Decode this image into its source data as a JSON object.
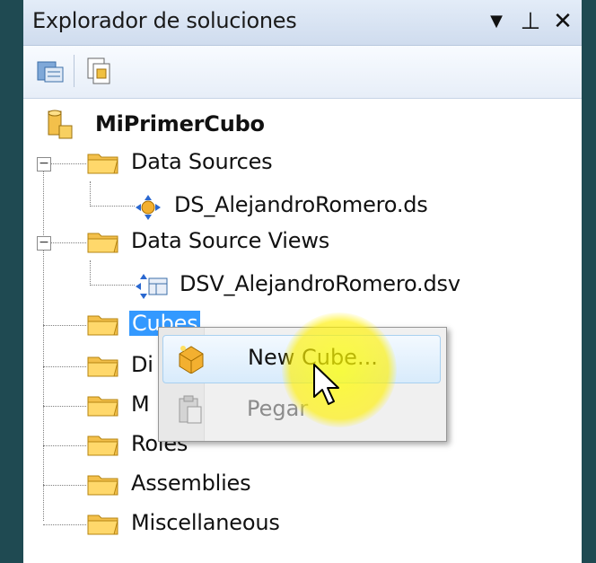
{
  "panel": {
    "title": "Explorador de soluciones",
    "buttons": {
      "dropdown": "▼",
      "pin": "⊥",
      "close": "✕"
    }
  },
  "toolbar": {
    "icons": [
      "properties-icon",
      "show-all-files-icon"
    ]
  },
  "tree": {
    "root": "MiPrimerCubo",
    "items": [
      {
        "label": "Data Sources",
        "children": [
          "DS_AlejandroRomero.ds"
        ]
      },
      {
        "label": "Data Source Views",
        "children": [
          "DSV_AlejandroRomero.dsv"
        ]
      },
      {
        "label": "Cubes"
      },
      {
        "label": "Di"
      },
      {
        "label": "M"
      },
      {
        "label": "Roles"
      },
      {
        "label": "Assemblies"
      },
      {
        "label": "Miscellaneous"
      }
    ]
  },
  "context_menu": {
    "items": [
      {
        "label": "New Cube...",
        "icon": "cube-icon",
        "enabled": true
      },
      {
        "label": "Pegar",
        "icon": "paste-icon",
        "enabled": false
      }
    ]
  },
  "colors": {
    "selection": "#3399ff",
    "highlight": "#ffff00",
    "folder": "#f3c04b"
  }
}
